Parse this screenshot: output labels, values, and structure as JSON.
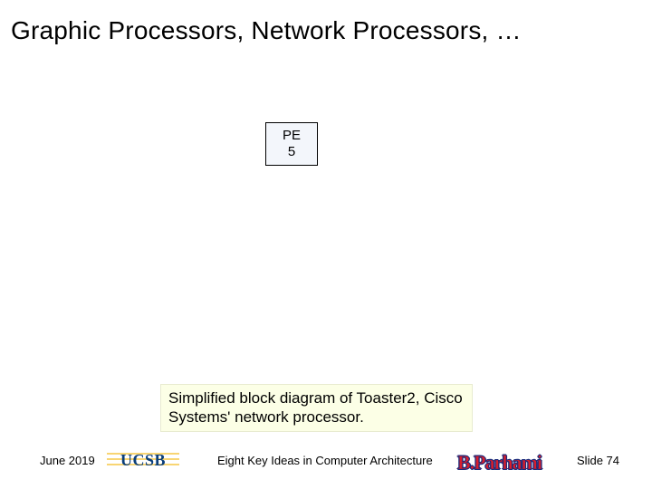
{
  "title": "Graphic Processors, Network Processors, …",
  "pe_box": {
    "line1": "PE",
    "line2": "5"
  },
  "caption": "Simplified block diagram of Toaster2, Cisco Systems' network processor.",
  "footer": {
    "date": "June 2019",
    "ucsb": "UCSB",
    "center": "Eight Key Ideas in Computer Architecture",
    "author": "B.Parhami",
    "slide": "Slide 74"
  }
}
